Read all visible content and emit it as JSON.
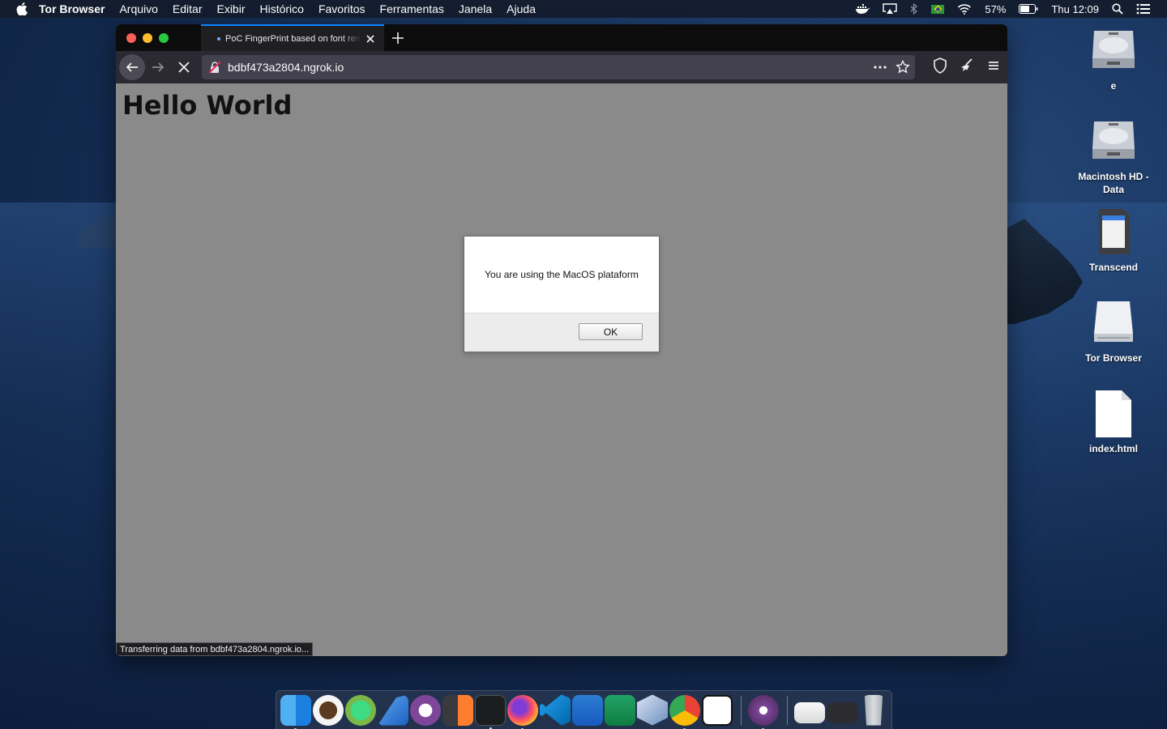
{
  "menubar": {
    "app_name": "Tor Browser",
    "menus": [
      "Arquivo",
      "Editar",
      "Exibir",
      "Histórico",
      "Favoritos",
      "Ferramentas",
      "Janela",
      "Ajuda"
    ],
    "battery": "57%",
    "clock": "Thu 12:09"
  },
  "browser": {
    "tab_title": "PoC FingerPrint based on font rendering",
    "url": "bdbf473a2804.ngrok.io",
    "status_text": "Transferring data from bdbf473a2804.ngrok.io..."
  },
  "page": {
    "heading": "Hello World"
  },
  "dialog": {
    "message": "You are using the MacOS plataform",
    "ok_label": "OK"
  },
  "desktop": {
    "icons": [
      {
        "label": "e",
        "icon": "hard-drive-icon"
      },
      {
        "label": "Macintosh HD - Data",
        "icon": "hard-drive-icon"
      },
      {
        "label": "Transcend",
        "icon": "sd-card-icon"
      },
      {
        "label": "Tor Browser",
        "icon": "disk-image-icon"
      },
      {
        "label": "index.html",
        "icon": "document-icon"
      }
    ]
  },
  "dock": {
    "apps": [
      "finder",
      "sequel-ace",
      "android-studio",
      "wireshark",
      "tor",
      "sublime-merge",
      "terminal",
      "firefox",
      "vscode",
      "word",
      "excel",
      "virtualbox",
      "chrome",
      "notion",
      "tor-browser",
      "screenshot",
      "vscode-window",
      "trash"
    ]
  },
  "colors": {
    "tab_accent": "#0a84ff",
    "page_background": "#8a8a8a",
    "toolbar": "#2b2a33"
  }
}
